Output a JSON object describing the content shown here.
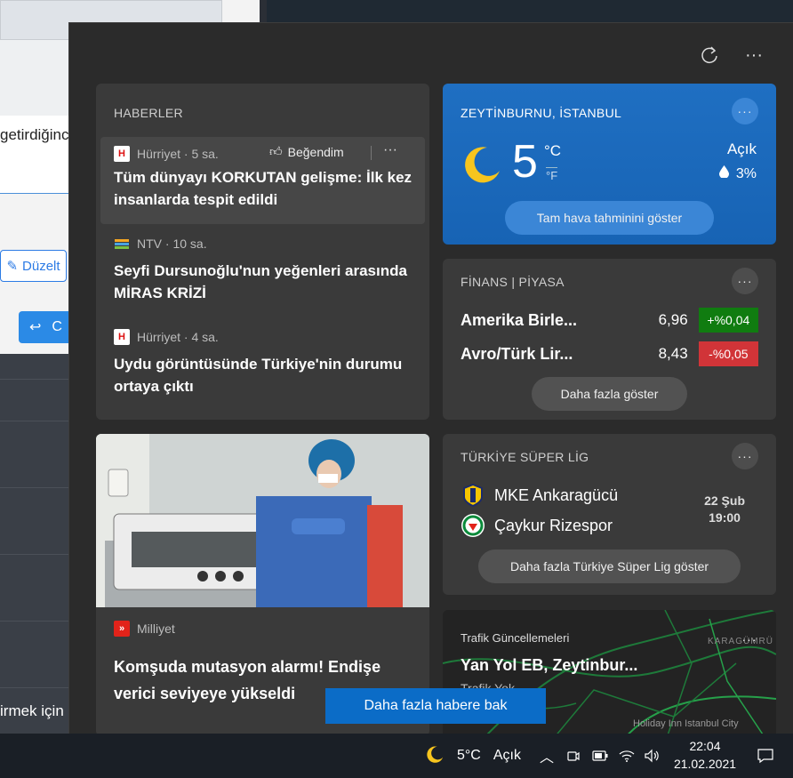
{
  "background_app": {
    "text_top": "getirdiğinc",
    "edit_label": "Düzelt",
    "reply_label": "C",
    "text_bottom": "irmek için"
  },
  "header": {
    "refresh_icon": "refresh-icon",
    "more_icon": "more-icon"
  },
  "news": {
    "title": "HABERLER",
    "like_label": "Beğendim",
    "items": [
      {
        "source": "Hürriyet · 5 sa.",
        "headline": "Tüm dünyayı KORKUTAN gelişme: İlk kez insanlarda tespit edildi"
      },
      {
        "source": "NTV · 10 sa.",
        "headline": "Seyfi Dursunoğlu'nun yeğenleri arasında MİRAS KRİZİ"
      },
      {
        "source": "Hürriyet · 4 sa.",
        "headline": "Uydu görüntüsünde Türkiye'nin durumu ortaya çıktı"
      }
    ]
  },
  "photo_story": {
    "source": "Milliyet",
    "headline": "Komşuda mutasyon alarmı! Endişe verici seviyeye yükseldi"
  },
  "weather": {
    "location": "ZEYTİNBURNU, İSTANBUL",
    "temperature": "5",
    "unit_c": "°C",
    "unit_f": "°F",
    "condition": "Açık",
    "precip": "3%",
    "forecast_label": "Tam hava tahminini göster"
  },
  "finance": {
    "title": "FİNANS | PİYASA",
    "rows": [
      {
        "name": "Amerika Birle...",
        "value": "6,96",
        "change": "+%0,04"
      },
      {
        "name": "Avro/Türk Lir...",
        "value": "8,43",
        "change": "-%0,05"
      }
    ],
    "more_label": "Daha fazla göster",
    "colors": {
      "up": "#107c10",
      "down": "#d13438"
    }
  },
  "sports": {
    "title": "TÜRKİYE SÜPER LİG",
    "home": "MKE Ankaragücü",
    "away": "Çaykur Rizespor",
    "date": "22 Şub",
    "time": "19:00",
    "more_label": "Daha fazla Türkiye Süper Lig göster"
  },
  "traffic": {
    "title": "Trafik Güncellemeleri",
    "route": "Yan Yol EB, Zeytinbur...",
    "sub": "Trafik Yok",
    "map_label1": "KARAGÜMRÜ",
    "map_label2": "Holiday Inn Istanbul City"
  },
  "more_news_label": "Daha fazla habere bak",
  "taskbar": {
    "weather_temp": "5°C",
    "weather_cond": "Açık",
    "time": "22:04",
    "date": "21.02.2021"
  }
}
